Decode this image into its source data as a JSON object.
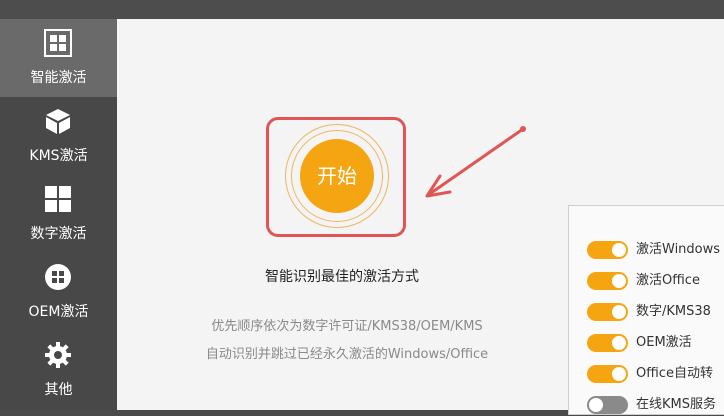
{
  "colors": {
    "accent": "#f5a512",
    "highlight": "#e05555",
    "sidebar": "#484848",
    "sidebar_active": "#6a6a6a"
  },
  "sidebar": {
    "items": [
      {
        "label": "智能激活",
        "icon": "windows-icon",
        "active": true
      },
      {
        "label": "KMS激活",
        "icon": "cube-icon",
        "active": false
      },
      {
        "label": "数字激活",
        "icon": "grid-icon",
        "active": false
      },
      {
        "label": "OEM激活",
        "icon": "windows-logo-circle-icon",
        "active": false
      },
      {
        "label": "其他",
        "icon": "gear-icon",
        "active": false
      }
    ]
  },
  "main": {
    "start_button_label": "开始",
    "subtitle": "智能识别最佳的激活方式",
    "description": [
      "优先顺序依次为数字许可证/KMS38/OEM/KMS",
      "自动识别并跳过已经永久激活的Windows/Office"
    ]
  },
  "options": [
    {
      "label": "激活Windows",
      "on": true
    },
    {
      "label": "激活Office",
      "on": true
    },
    {
      "label": "数字/KMS38",
      "on": true
    },
    {
      "label": "OEM激活",
      "on": true
    },
    {
      "label": "Office自动转",
      "on": true
    },
    {
      "label": "在线KMS服务",
      "on": false
    }
  ]
}
